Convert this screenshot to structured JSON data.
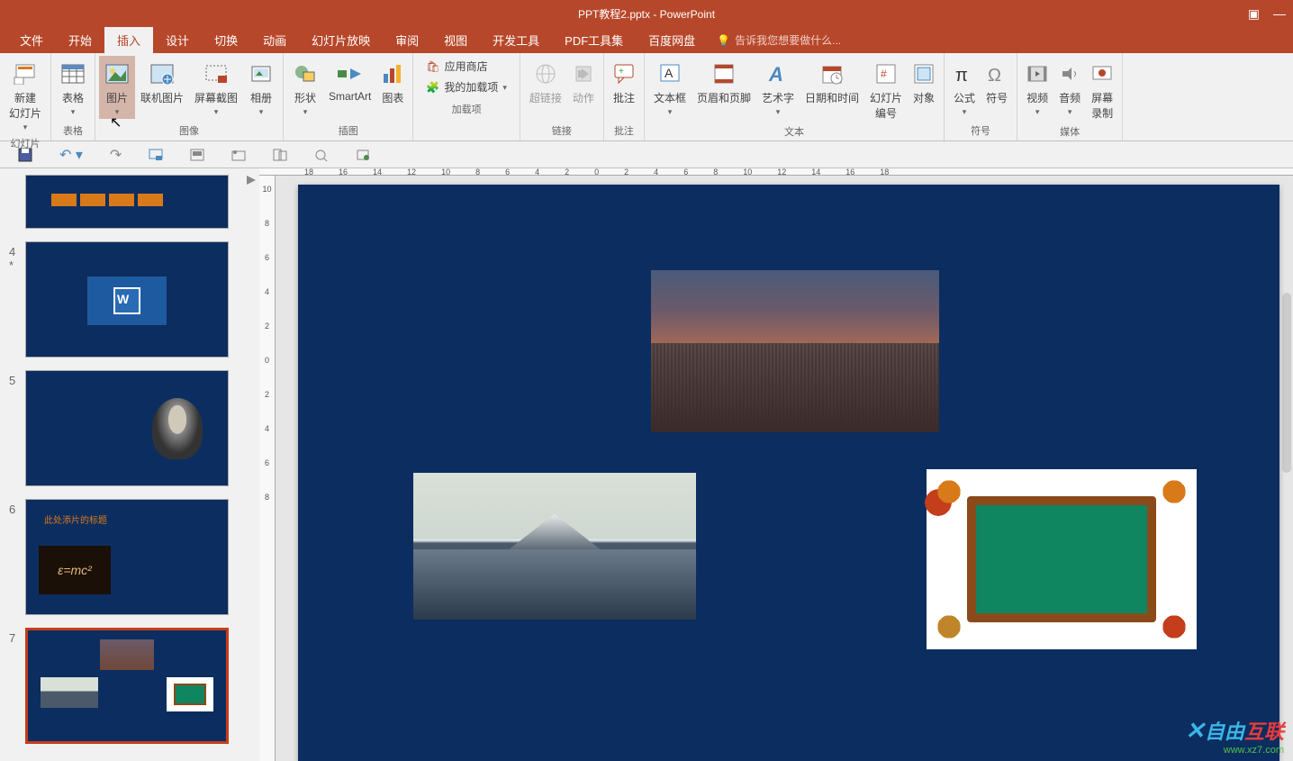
{
  "title_bar": {
    "document_title": "PPT教程2.pptx - PowerPoint"
  },
  "menu": {
    "file": "文件",
    "home": "开始",
    "insert": "插入",
    "design": "设计",
    "transitions": "切换",
    "animations": "动画",
    "slideshow": "幻灯片放映",
    "review": "审阅",
    "view": "视图",
    "developer": "开发工具",
    "pdf_tools": "PDF工具集",
    "baidu": "百度网盘",
    "tell_me": "告诉我您想要做什么..."
  },
  "ribbon": {
    "new_slide": "新建\n幻灯片",
    "table": "表格",
    "picture": "图片",
    "online_pic": "联机图片",
    "screenshot": "屏幕截图",
    "album": "相册",
    "shape": "形状",
    "smartart": "SmartArt",
    "chart": "图表",
    "app_store": "应用商店",
    "my_addins": "我的加载项",
    "hyperlink": "超链接",
    "action": "动作",
    "comment": "批注",
    "textbox": "文本框",
    "header_footer": "页眉和页脚",
    "wordart": "艺术字",
    "date_time": "日期和时间",
    "slide_number": "幻灯片\n编号",
    "object": "对象",
    "equation": "公式",
    "symbol": "符号",
    "video": "视频",
    "audio": "音频",
    "screen_record": "屏幕\n录制",
    "groups": {
      "slides": "幻灯片",
      "tables": "表格",
      "images": "图像",
      "illustrations": "插图",
      "addins": "加载项",
      "links": "链接",
      "comments": "批注",
      "text": "文本",
      "symbols": "符号",
      "media": "媒体"
    }
  },
  "ruler_h": [
    "18",
    "16",
    "14",
    "12",
    "10",
    "8",
    "6",
    "4",
    "2",
    "0",
    "2",
    "4",
    "6",
    "8",
    "10",
    "12",
    "14",
    "16",
    "18"
  ],
  "ruler_v": [
    "10",
    "8",
    "6",
    "4",
    "2",
    "0",
    "2",
    "4",
    "6",
    "8"
  ],
  "slides": {
    "s4": "4",
    "s4_star": "*",
    "s5": "5",
    "s6": "6",
    "s6_title": "此处添片的标题",
    "s6_formula": "ε=mc²",
    "s7": "7"
  },
  "watermark": {
    "main_blue": "自由",
    "main_red": "互联",
    "sub": "www.xz7.com"
  }
}
